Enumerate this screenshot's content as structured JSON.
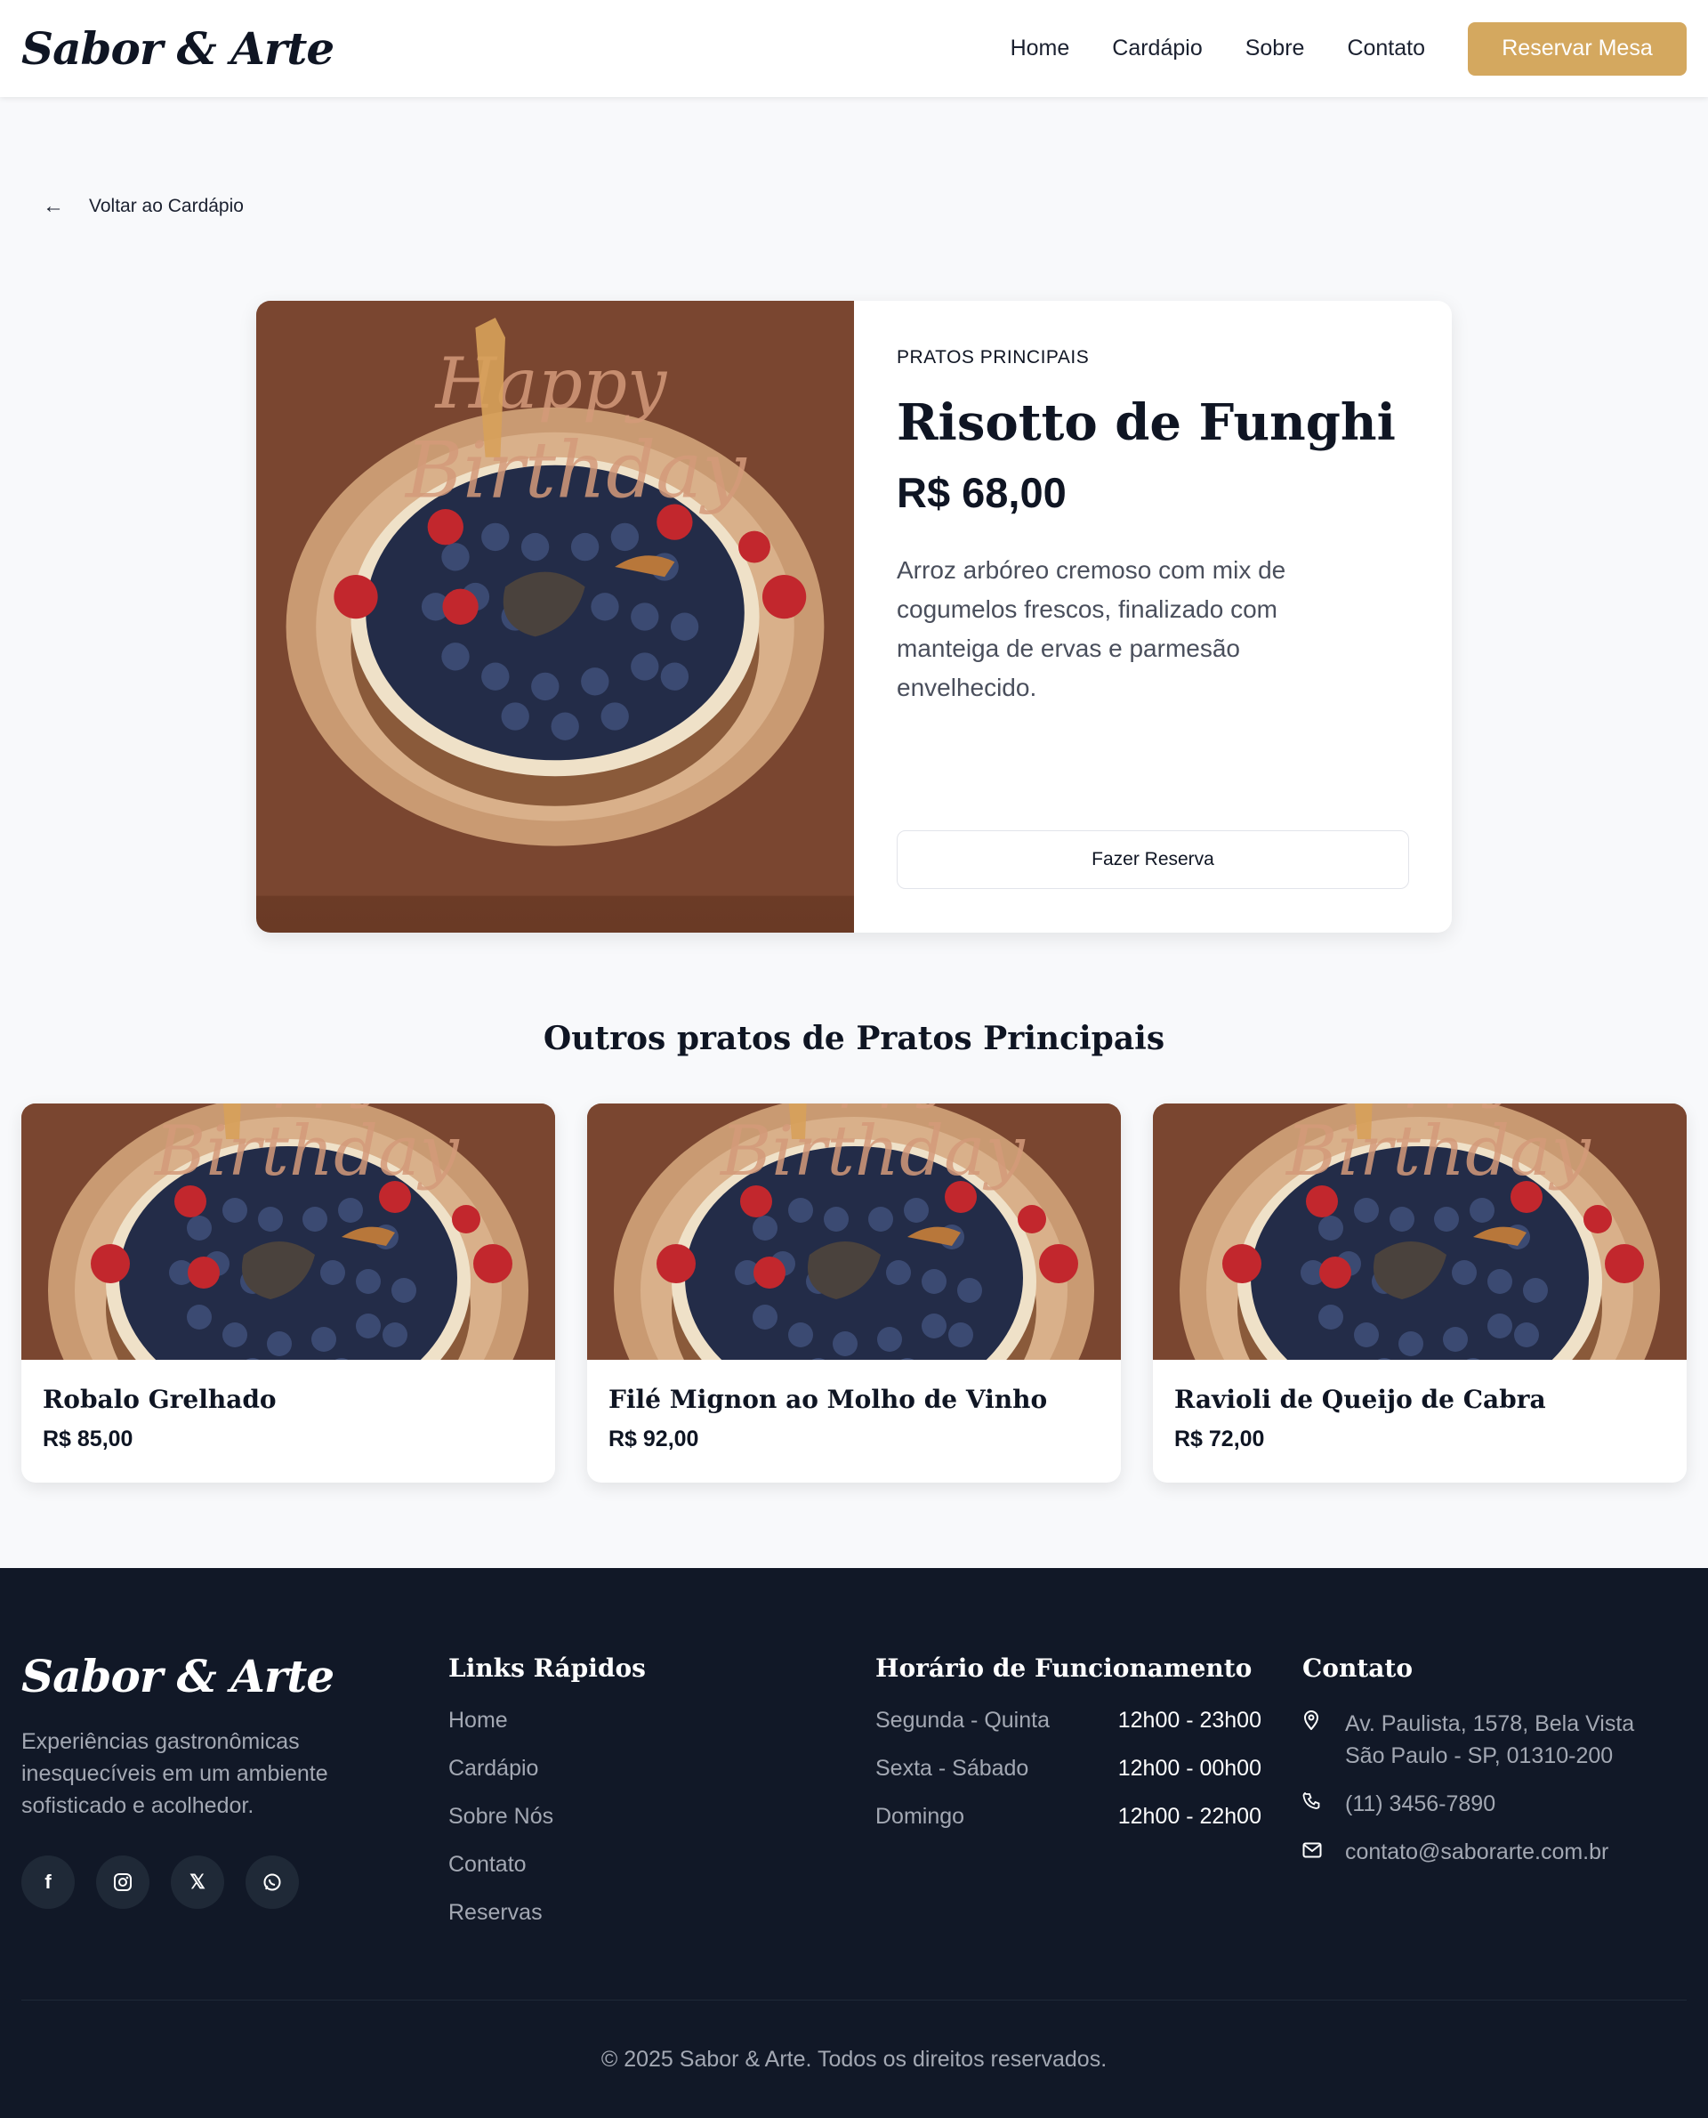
{
  "header": {
    "logo": "Sabor & Arte",
    "nav": [
      "Home",
      "Cardápio",
      "Sobre",
      "Contato"
    ],
    "cta": "Reservar Mesa"
  },
  "back_link": "Voltar ao Cardápio",
  "product": {
    "category": "PRATOS PRINCIPAIS",
    "name": "Risotto de Funghi",
    "price": "R$ 68,00",
    "description": "Arroz arbóreo cremoso com mix de cogumelos frescos, finalizado com manteiga de ervas e parmesão envelhecido.",
    "button": "Fazer Reserva"
  },
  "related": {
    "title": "Outros pratos de Pratos Principais",
    "items": [
      {
        "name": "Robalo Grelhado",
        "price": "R$ 85,00"
      },
      {
        "name": "Filé Mignon ao Molho de Vinho",
        "price": "R$ 92,00"
      },
      {
        "name": "Ravioli de Queijo de Cabra",
        "price": "R$ 72,00"
      }
    ]
  },
  "footer": {
    "logo": "Sabor & Arte",
    "tagline": "Experiências gastronômicas inesquecíveis em um ambiente sofisticado e acolhedor.",
    "socials": [
      "facebook-icon",
      "instagram-icon",
      "x-icon",
      "whatsapp-icon"
    ],
    "links_title": "Links Rápidos",
    "links": [
      "Home",
      "Cardápio",
      "Sobre Nós",
      "Contato",
      "Reservas"
    ],
    "hours_title": "Horário de Funcionamento",
    "hours": [
      {
        "day": "Segunda - Quinta",
        "time": "12h00 - 23h00"
      },
      {
        "day": "Sexta - Sábado",
        "time": "12h00 - 00h00"
      },
      {
        "day": "Domingo",
        "time": "12h00 - 22h00"
      }
    ],
    "contact_title": "Contato",
    "address_line1": "Av. Paulista, 1578, Bela Vista",
    "address_line2": "São Paulo - SP, 01310-200",
    "phone": "(11) 3456-7890",
    "email": "contato@saborarte.com.br",
    "copyright": "© 2025 Sabor & Arte. Todos os direitos reservados."
  },
  "colors": {
    "accent": "#d4a85f",
    "footer_bg": "#111827",
    "page_bg": "#f8f9fb"
  }
}
